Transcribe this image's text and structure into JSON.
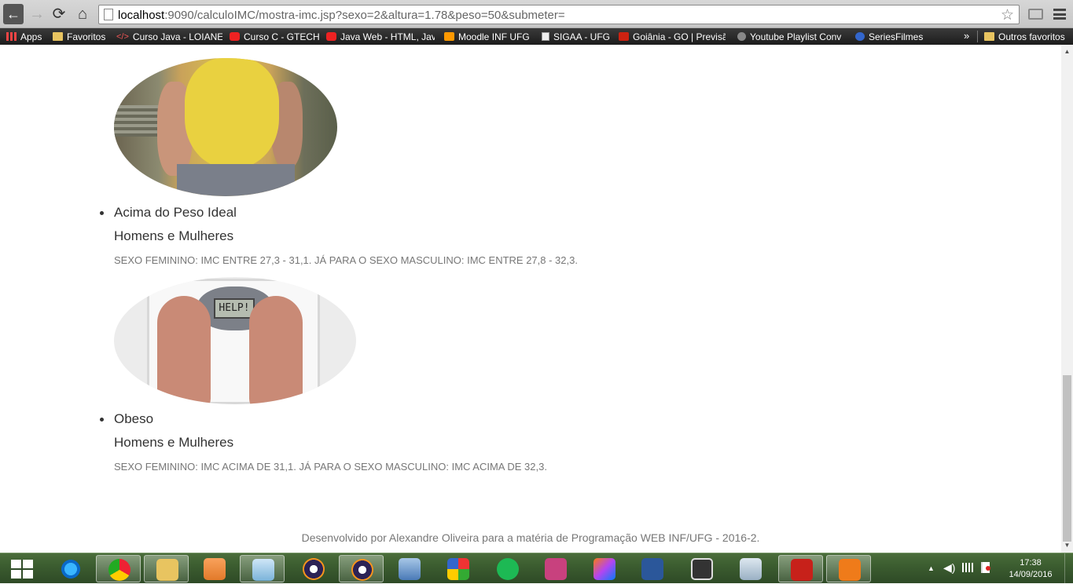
{
  "browser": {
    "url_host": "localhost",
    "url_rest": ":9090/calculoIMC/mostra-imc.jsp?sexo=2&altura=1.78&peso=50&submeter=",
    "back_glyph": "←",
    "forward_glyph": "→",
    "reload_glyph": "⟳",
    "home_glyph": "⌂",
    "star_glyph": "☆"
  },
  "bookmarks": {
    "items": [
      {
        "label": "Apps",
        "icon": "apps-icon"
      },
      {
        "label": "Favoritos",
        "icon": "folder-icon"
      },
      {
        "label": "Curso Java - LOIANE",
        "icon": "code-icon"
      },
      {
        "label": "Curso C - GTECH",
        "icon": "youtube-icon"
      },
      {
        "label": "Java Web - HTML, Jav",
        "icon": "youtube-icon"
      },
      {
        "label": "Moodle INF UFG",
        "icon": "moodle-icon"
      },
      {
        "label": "SIGAA - UFG",
        "icon": "page-icon"
      },
      {
        "label": "Goiânia - GO | Previsã",
        "icon": "weather-icon"
      },
      {
        "label": "Youtube Playlist Conv",
        "icon": "music-icon"
      },
      {
        "label": "SeriesFilmes",
        "icon": "series-icon"
      }
    ],
    "more": "»",
    "other_folder": "Outros favoritos"
  },
  "page": {
    "items": [
      {
        "title": "Acima do Peso Ideal",
        "subtitle": "Homens e Mulheres",
        "description": "SEXO FEMININO: IMC ENTRE 27,3 - 31,1. JÁ PARA O SEXO MASCULINO: IMC ENTRE 27,8 - 32,3."
      },
      {
        "title": "Obeso",
        "subtitle": "Homens e Mulheres",
        "description": "SEXO FEMININO: IMC ACIMA DE 31,1. JÁ PARA O SEXO MASCULINO: IMC ACIMA DE 32,3."
      }
    ],
    "scale_display_text": "HELP!",
    "footer": "Desenvolvido por Alexandre Oliveira para a matéria de Programação WEB INF/UFG - 2016-2."
  },
  "taskbar": {
    "apps": [
      {
        "name": "internet-explorer-icon",
        "active": false
      },
      {
        "name": "chrome-icon",
        "active": true
      },
      {
        "name": "file-explorer-icon",
        "active": true
      },
      {
        "name": "media-player-icon",
        "active": false
      },
      {
        "name": "notepad-icon",
        "active": true
      },
      {
        "name": "eclipse-icon",
        "active": false
      },
      {
        "name": "eclipse-icon",
        "active": true
      },
      {
        "name": "virtualbox-icon",
        "active": false
      },
      {
        "name": "windows-logo-icon",
        "active": false
      },
      {
        "name": "spotify-icon",
        "active": false
      },
      {
        "name": "astah-icon",
        "active": false
      },
      {
        "name": "intellij-icon",
        "active": false
      },
      {
        "name": "word-icon",
        "active": false
      },
      {
        "name": "terminal-icon",
        "active": false
      },
      {
        "name": "calculator-icon",
        "active": false
      },
      {
        "name": "acrobat-icon",
        "active": true
      },
      {
        "name": "foxit-pdf-icon",
        "active": true
      }
    ],
    "clock_time": "17:38",
    "clock_date": "14/09/2016"
  }
}
